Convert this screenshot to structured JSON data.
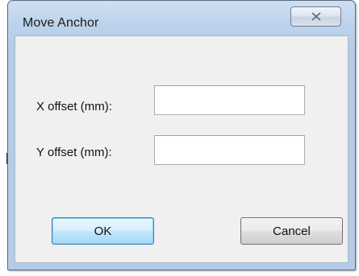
{
  "window": {
    "title": "Move Anchor",
    "close_icon": "close-icon"
  },
  "form": {
    "x_offset_label": "X offset (mm):",
    "x_offset_value": "",
    "y_offset_label": "Y offset (mm):",
    "y_offset_value": ""
  },
  "buttons": {
    "ok_label": "OK",
    "cancel_label": "Cancel"
  }
}
